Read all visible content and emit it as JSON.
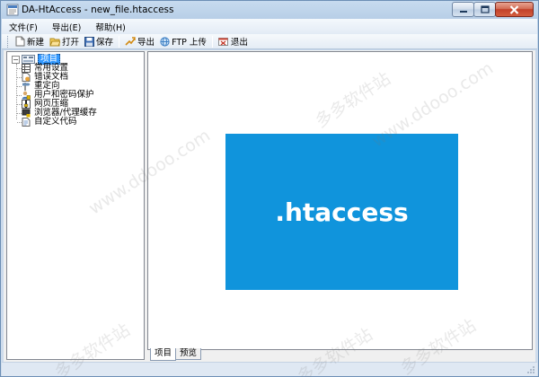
{
  "window": {
    "title": "DA-HtAccess - new_file.htaccess",
    "min_icon": "minimize-icon",
    "max_icon": "maximize-icon",
    "close_icon": "close-icon"
  },
  "menu": [
    "文件(F)",
    "导出(E)",
    "帮助(H)"
  ],
  "toolbar": {
    "new_label": "新建",
    "open_label": "打开",
    "save_label": "保存",
    "export_label": "导出",
    "ftp_label": "FTP 上传",
    "exit_label": "退出"
  },
  "tree": {
    "root_label": "项目",
    "root_expander": "−",
    "items": [
      {
        "label": "常用设置",
        "icon": "settings-grid-icon"
      },
      {
        "label": "错误文档",
        "icon": "document-error-icon"
      },
      {
        "label": "重定向",
        "icon": "redirect-signpost-icon"
      },
      {
        "label": "用户和密码保护",
        "icon": "user-lock-icon"
      },
      {
        "label": "网页压缩",
        "icon": "compress-icon"
      },
      {
        "label": "浏览器/代理缓存",
        "icon": "cache-icon"
      },
      {
        "label": "自定义代码",
        "icon": "custom-code-icon"
      }
    ]
  },
  "main": {
    "logo_text": ".htaccess",
    "logo_color": "#1094dc"
  },
  "tabs": [
    "项目",
    "预览"
  ],
  "watermark": {
    "site": "www.ddooo.com",
    "brand": "多多软件站"
  }
}
